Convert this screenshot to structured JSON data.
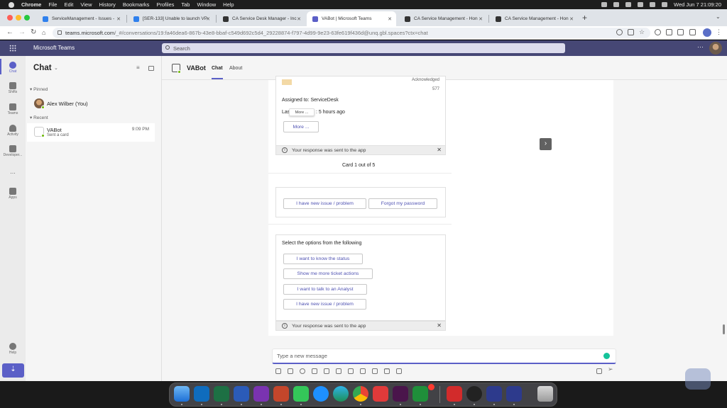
{
  "menubar": {
    "app": "Chrome",
    "items": [
      "File",
      "Edit",
      "View",
      "History",
      "Bookmarks",
      "Profiles",
      "Tab",
      "Window",
      "Help"
    ],
    "clock": "Wed Jun 7  21:09:20"
  },
  "browser": {
    "tabs": [
      {
        "title": "ServiceManagement - Issues -",
        "color": "#2f80ed"
      },
      {
        "title": "[SER-133] Unable to launch VP",
        "color": "#2f80ed"
      },
      {
        "title": "CA Service Desk Manager - Inc",
        "color": "#333333"
      },
      {
        "title": "VABot | Microsoft Teams",
        "color": "#5b5fc7"
      },
      {
        "title": "CA Service Management - Hon",
        "color": "#333333"
      },
      {
        "title": "CA Service Management - Hon",
        "color": "#333333"
      }
    ],
    "url_main": "teams.microsoft.com",
    "url_rest": "/_#/conversations/19:fa46dea6-867b-43e8-bbaf-c549d692c5d4_29228874-f797-4d99-9e23-63fe619f436d@unq.gbl.spaces?ctx=chat"
  },
  "teams": {
    "title": "Microsoft Teams",
    "search_placeholder": "Search",
    "rail": [
      {
        "label": "Chat",
        "icon": "chat-icon"
      },
      {
        "label": "Shifts",
        "icon": "shifts-icon"
      },
      {
        "label": "Teams",
        "icon": "teams-icon"
      },
      {
        "label": "Activity",
        "icon": "activity-icon"
      },
      {
        "label": "Developer...",
        "icon": "developer-icon"
      },
      {
        "label": "...",
        "icon": "more-icon"
      },
      {
        "label": "Apps",
        "icon": "apps-icon"
      },
      {
        "label": "Help",
        "icon": "help-icon"
      }
    ]
  },
  "chatlist": {
    "title": "Chat",
    "pinned_label": "Pinned",
    "recent_label": "Recent",
    "pinned": {
      "name": "Alex Wilber (You)"
    },
    "recent": {
      "name": "VABot",
      "sub": "Sent a card",
      "time": "9:09 PM"
    }
  },
  "conversation": {
    "bot_name": "VABot",
    "tabs": [
      "Chat",
      "About"
    ],
    "card1": {
      "top_partial": "Acknowledged",
      "number": "577",
      "assigned": "Assigned to: ServiceDesk",
      "last_prefix": "Las",
      "last_suffix": ": 5 hours ago",
      "tooltip": "More ...",
      "more_button": "More ...",
      "response": "Your response was sent to the app",
      "counter": "Card 1 out of 5"
    },
    "card2": {
      "buttons": [
        "I have new issue / problem",
        "Forgot my password"
      ]
    },
    "card3": {
      "heading": "Select the options from the following",
      "buttons": [
        "I want to know the status",
        "Show me more ticket actions",
        "I want to talk to an Analyst",
        "I have new issue / problem"
      ],
      "response": "Your response was sent to the app"
    },
    "compose_placeholder": "Type a new message"
  }
}
